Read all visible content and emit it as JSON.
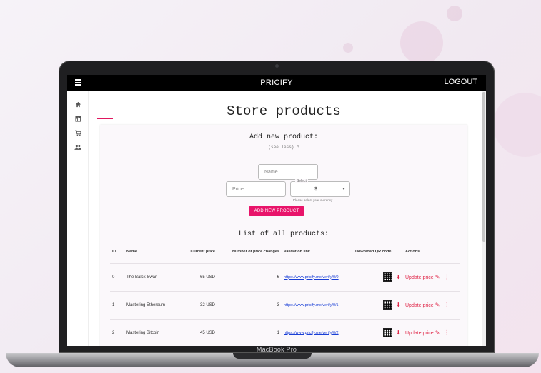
{
  "app": {
    "title": "PRICIFY",
    "logout_label": "LOGOUT",
    "device_label": "MacBook Pro"
  },
  "sidebar": {
    "items": [
      {
        "icon": "home-icon",
        "glyph": "⌂"
      },
      {
        "icon": "chart-icon",
        "glyph": "▥"
      },
      {
        "icon": "cart-icon",
        "glyph": "🛒"
      },
      {
        "icon": "users-icon",
        "glyph": "👥"
      }
    ]
  },
  "page": {
    "title": "Store products"
  },
  "add_form": {
    "title": "Add new product:",
    "toggle_label": "(see less) ^",
    "name_placeholder": "Name",
    "price_placeholder": "Price",
    "currency_legend": "Select",
    "currency_value": "$",
    "currency_helper": "Please select your currency",
    "submit_label": "ADD NEW PRODUCT"
  },
  "products": {
    "title": "List of all products:",
    "columns": [
      "ID",
      "Name",
      "Current price",
      "Number of price changes",
      "Validation link",
      "Download QR code",
      "Actions"
    ],
    "rows": [
      {
        "id": "0",
        "name": "The Balck Swan",
        "price": "65 USD",
        "changes": "6",
        "link": "https://www.pricify.me/verify/0/0"
      },
      {
        "id": "1",
        "name": "Mastering Ethereum",
        "price": "32 USD",
        "changes": "3",
        "link": "https://www.pricify.me/verify/0/1"
      },
      {
        "id": "2",
        "name": "Mastering Bitcoin",
        "price": "45 USD",
        "changes": "1",
        "link": "https://www.pricify.me/verify/0/2"
      }
    ],
    "update_label": "Update price"
  },
  "colors": {
    "accent": "#e8146a",
    "action": "#e0294a",
    "link": "#1a3fd6",
    "appbar": "#000000"
  }
}
